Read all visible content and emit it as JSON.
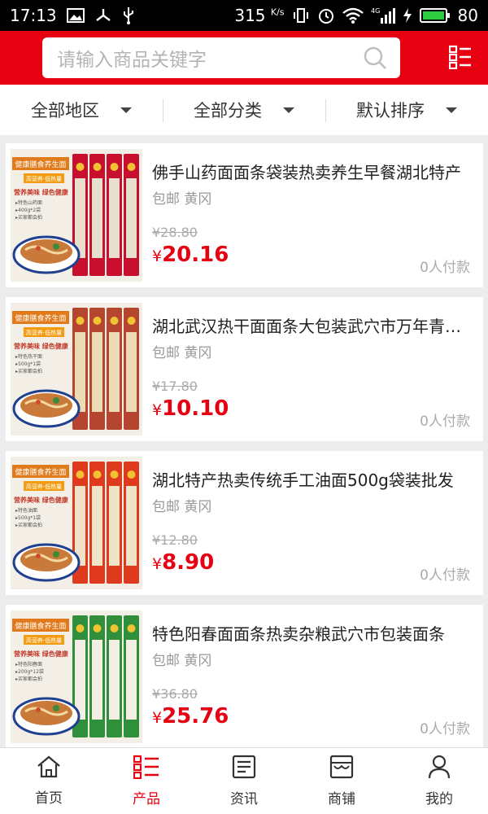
{
  "status_bar": {
    "time": "17:13",
    "net_speed": "315",
    "net_unit": "K/s",
    "network": "4G",
    "battery": "80"
  },
  "search": {
    "placeholder": "请输入商品关键字"
  },
  "filters": [
    {
      "label": "全部地区"
    },
    {
      "label": "全部分类"
    },
    {
      "label": "默认排序"
    }
  ],
  "products": [
    {
      "title": "佛手山药面面条袋装热卖养生早餐湖北特产",
      "shipping": "包邮",
      "location": "黄冈",
      "old_price": "¥28.80",
      "currency": "¥",
      "price": "20.16",
      "buyers": "0人付款",
      "banner_title": "健康膳食养生面",
      "banner_sub": "高营养·低热量",
      "banner_slogan": "营养美味 绿色健康",
      "banner_item1": "▸特色山药面",
      "banner_item2": "▸400g*2袋",
      "banner_item3": "▸买家都会拍",
      "pack_color": "#c8102e",
      "noodle_color": "#e8e0cf"
    },
    {
      "title": "湖北武汉热干面面条大包装武穴市万年青食品",
      "shipping": "包邮",
      "location": "黄冈",
      "old_price": "¥17.80",
      "currency": "¥",
      "price": "10.10",
      "buyers": "0人付款",
      "banner_title": "健康膳食养生面",
      "banner_sub": "高营养·低热量",
      "banner_slogan": "营养美味 绿色健康",
      "banner_item1": "▸特色热干面",
      "banner_item2": "▸500g*1袋",
      "banner_item3": "▸买家都会拍",
      "pack_color": "#b5452f",
      "noodle_color": "#ecdcb6"
    },
    {
      "title": "湖北特产热卖传统手工油面500g袋装批发",
      "shipping": "包邮",
      "location": "黄冈",
      "old_price": "¥12.80",
      "currency": "¥",
      "price": "8.90",
      "buyers": "0人付款",
      "banner_title": "健康膳食养生面",
      "banner_sub": "高营养·低热量",
      "banner_slogan": "营养美味 绿色健康",
      "banner_item1": "▸特色油面",
      "banner_item2": "▸500g*1袋",
      "banner_item3": "▸买家都会拍",
      "pack_color": "#e03a1e",
      "noodle_color": "#f0e4c8"
    },
    {
      "title": "特色阳春面面条热卖杂粮武穴市包装面条",
      "shipping": "包邮",
      "location": "黄冈",
      "old_price": "¥36.80",
      "currency": "¥",
      "price": "25.76",
      "buyers": "0人付款",
      "banner_title": "健康膳食养生面",
      "banner_sub": "高营养·低热量",
      "banner_slogan": "营养美味 绿色健康",
      "banner_item1": "▸特色阳春面",
      "banner_item2": "▸200g*12袋",
      "banner_item3": "▸买家都会拍",
      "pack_color": "#2f8f3a",
      "noodle_color": "#f3efe4"
    }
  ],
  "tabbar": [
    {
      "label": "首页",
      "icon": "home-icon",
      "active": false
    },
    {
      "label": "产品",
      "icon": "product-list-icon",
      "active": true
    },
    {
      "label": "资讯",
      "icon": "news-icon",
      "active": false
    },
    {
      "label": "商铺",
      "icon": "store-icon",
      "active": false
    },
    {
      "label": "我的",
      "icon": "user-icon",
      "active": false
    }
  ],
  "colors": {
    "accent": "#e60012",
    "background": "#ececec"
  }
}
